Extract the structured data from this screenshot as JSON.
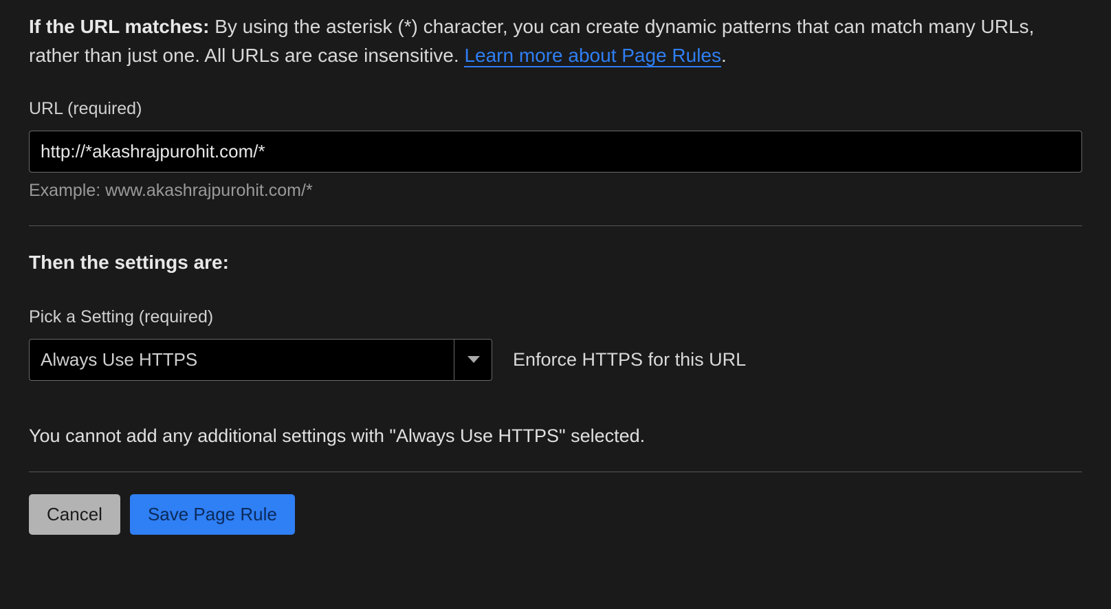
{
  "intro": {
    "label": "If the URL matches:",
    "text": "By using the asterisk (*) character, you can create dynamic patterns that can match many URLs, rather than just one. All URLs are case insensitive. ",
    "link_text": "Learn more about Page Rules",
    "period": "."
  },
  "url_section": {
    "label": "URL (required)",
    "value": "http://*akashrajpurohit.com/*",
    "example": "Example: www.akashrajpurohit.com/*"
  },
  "settings_section": {
    "heading": "Then the settings are:",
    "pick_label": "Pick a Setting (required)",
    "selected_option": "Always Use HTTPS",
    "description": "Enforce HTTPS for this URL",
    "warning": "You cannot add any additional settings with \"Always Use HTTPS\" selected."
  },
  "buttons": {
    "cancel": "Cancel",
    "save": "Save Page Rule"
  }
}
